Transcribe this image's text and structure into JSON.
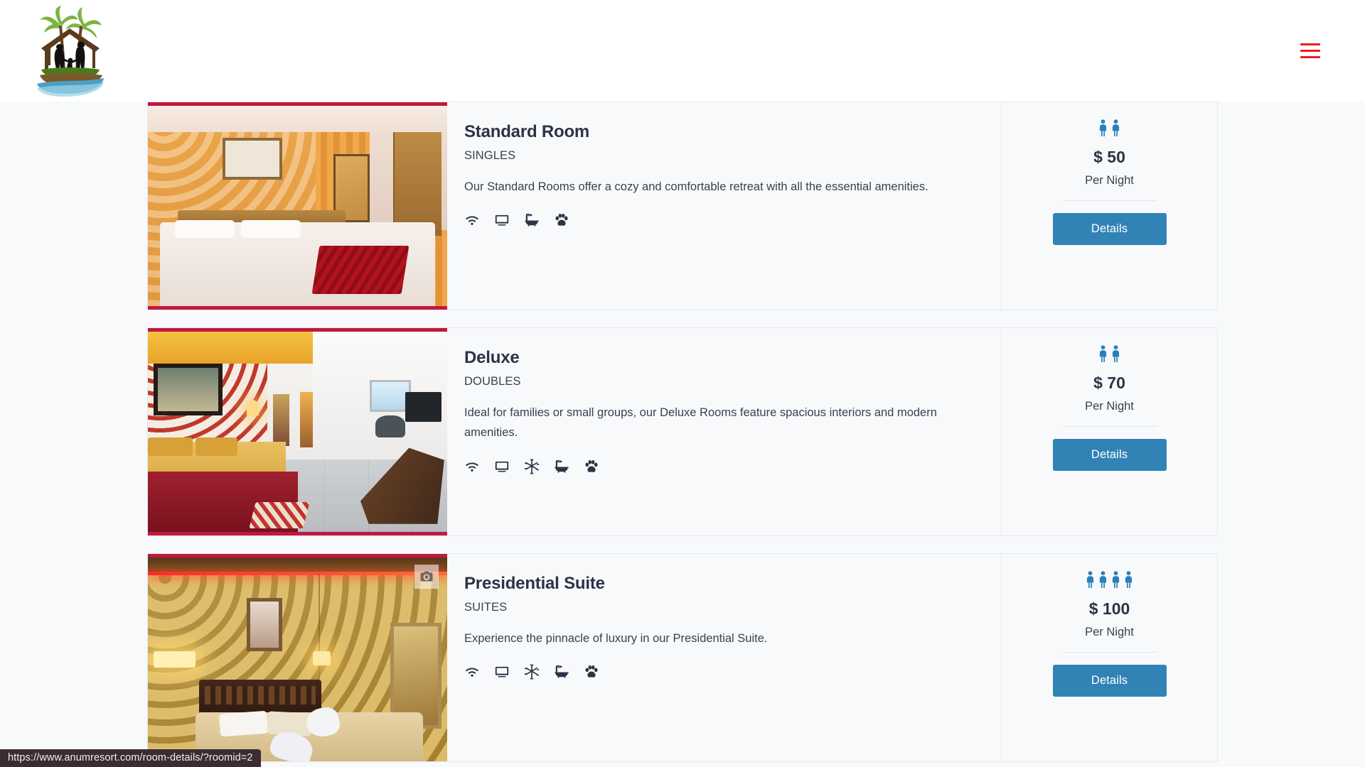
{
  "header": {
    "logo_alt": "Anum Resort logo",
    "menu_icon": "hamburger-menu-icon",
    "menu_color": "#ee1d23"
  },
  "theme": {
    "page_background": "#f7f9fa",
    "card_background": "#f8f9fb",
    "card_border": "#e6e9ed",
    "accent_blue": "#3183b5",
    "occupancy_blue": "#2980b9",
    "photo_border_crimson": "#c2173f",
    "heading_color": "#2b3445"
  },
  "rooms": [
    {
      "title": "Standard Room",
      "category": "SINGLES",
      "description": "Our Standard Rooms offer a cozy and comfortable retreat with all the essential amenities.",
      "amenities": [
        "wifi-icon",
        "tv-icon",
        "bathtub-icon",
        "paw-icon"
      ],
      "occupancy": 2,
      "price": "$ 50",
      "price_period": "Per Night",
      "details_label": "Details",
      "photo_alt": "Standard room with orange patterned wallpaper and white bedding",
      "has_camera_badge": false
    },
    {
      "title": "Deluxe",
      "category": "DOUBLES",
      "description": "Ideal for families or small groups, our Deluxe Rooms feature spacious interiors and modern amenities.",
      "amenities": [
        "wifi-icon",
        "tv-icon",
        "snowflake-icon",
        "bathtub-icon",
        "paw-icon"
      ],
      "occupancy": 2,
      "price": "$ 70",
      "price_period": "Per Night",
      "details_label": "Details",
      "photo_alt": "Deluxe room with floral wallpaper, red bedspread and seating area",
      "has_camera_badge": false
    },
    {
      "title": "Presidential Suite",
      "category": "SUITES",
      "description": "Experience the pinnacle of luxury in our Presidential Suite.",
      "amenities": [
        "wifi-icon",
        "tv-icon",
        "snowflake-icon",
        "bathtub-icon",
        "paw-icon"
      ],
      "occupancy": 4,
      "price": "$ 100",
      "price_period": "Per Night",
      "details_label": "Details",
      "photo_alt": "Presidential suite with gold damask wallpaper and towel swans",
      "has_camera_badge": true
    }
  ],
  "status_bar": {
    "url": "https://www.anumresort.com/room-details/?roomid=2"
  }
}
